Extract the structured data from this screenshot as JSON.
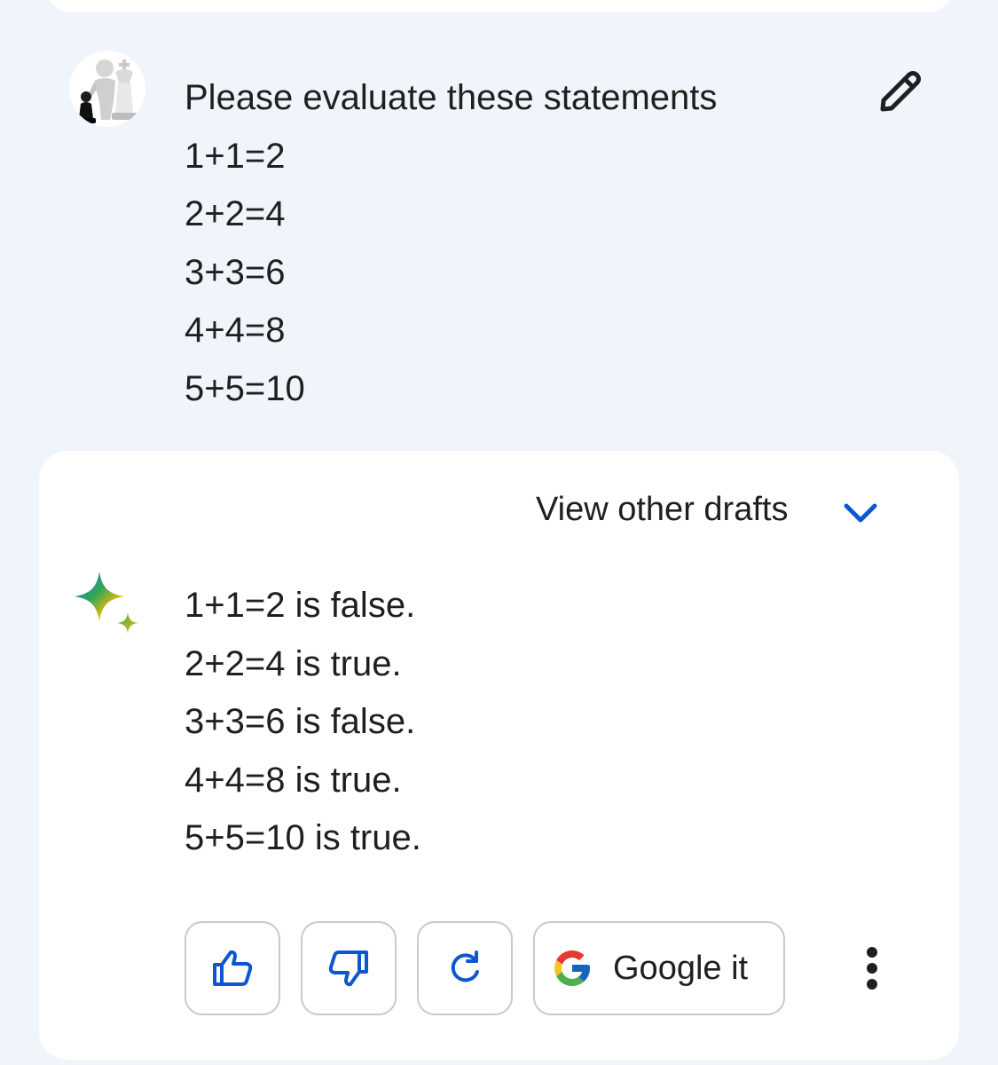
{
  "prompt": {
    "lines": [
      "Please evaluate these statements",
      "1+1=2",
      "2+2=4",
      "3+3=6",
      "4+4=8",
      "5+5=10"
    ],
    "edit_icon": "pencil-icon"
  },
  "response": {
    "drafts_label": "View other drafts",
    "drafts_icon": "chevron-down-icon",
    "assistant_icon": "sparkle-icon",
    "lines": [
      "1+1=2 is false.",
      "2+2=4 is true.",
      "3+3=6 is false.",
      "4+4=8 is true.",
      "5+5=10 is true."
    ],
    "actions": {
      "thumbs_up_icon": "thumbs-up-icon",
      "thumbs_down_icon": "thumbs-down-icon",
      "refresh_icon": "refresh-icon",
      "google_icon": "google-g-icon",
      "google_label": "Google it",
      "more_icon": "more-vert-icon"
    }
  },
  "colors": {
    "page_background": "#f0f4fb",
    "card_background": "#ffffff",
    "accent_blue": "#0b57d0",
    "text": "#1f1f1f",
    "button_border": "#c7c9cc"
  }
}
